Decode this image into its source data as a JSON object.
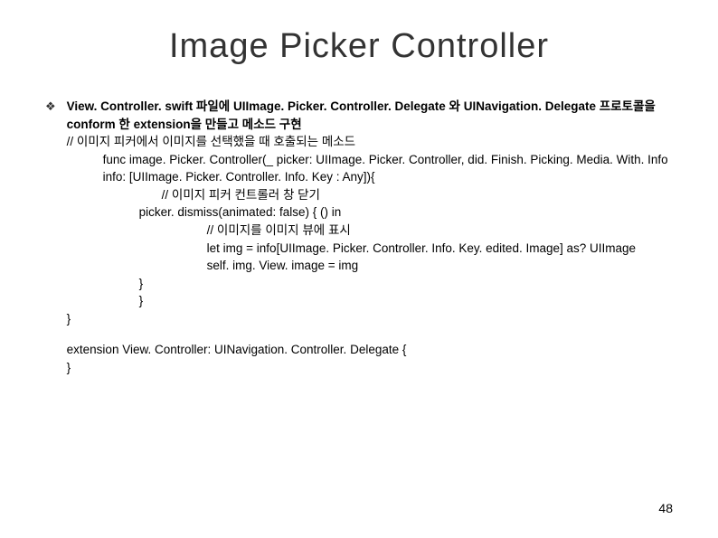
{
  "title": "Image Picker Controller",
  "bullet_heading": "View. Controller. swift 파일에 UIImage. Picker. Controller. Delegate 와 UINavigation. Delegate 프로토콜을 conform 한 extension을 만들고 메소드 구현",
  "comment_1": " // 이미지 피커에서 이미지를 선택했을 때 호출되는 메소드",
  "func_signature": "func image. Picker. Controller(_ picker: UIImage. Picker. Controller, did. Finish. Picking. Media. With. Info info: [UIImage. Picker. Controller. Info. Key : Any]){",
  "comment_2": "// 이미지 피커 컨트롤러 창 닫기",
  "dismiss_line": "picker. dismiss(animated: false) { () in",
  "comment_3": "// 이미지를 이미지 뷰에 표시",
  "let_img_line": "let img = info[UIImage. Picker. Controller. Info. Key. edited. Image] as? UIImage",
  "self_line": "self. img. View. image = img",
  "close_1": "}",
  "close_2": "}",
  "close_3": "}",
  "extension_line_1": "extension View. Controller: UINavigation. Controller. Delegate {",
  "extension_line_2": "}",
  "page_number": "48"
}
